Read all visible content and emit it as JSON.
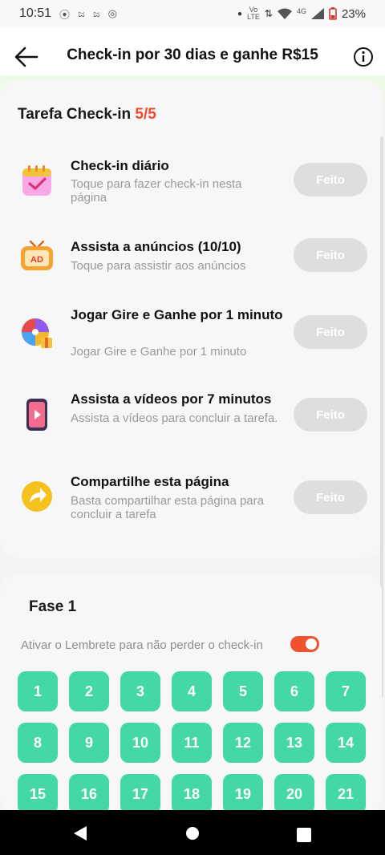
{
  "status_bar": {
    "time": "10:51",
    "net_top": "Vo",
    "net_bottom": "LTE",
    "net_type": "4G",
    "battery": "23%"
  },
  "header": {
    "title": "Check-in por 30 dias e ganhe R$15"
  },
  "tasks_card": {
    "title": "Tarefa Check-in",
    "count": "5/5",
    "tasks": [
      {
        "name": "Check-in diário",
        "desc": "Toque para fazer check-in nesta página",
        "button": "Feito",
        "icon": "calendar-check-icon"
      },
      {
        "name": "Assista a anúncios  (10/10)",
        "desc": "Toque para assistir aos anúncios",
        "button": "Feito",
        "icon": "ad-tv-icon"
      },
      {
        "name": "Jogar Gire e Ganhe por 1 minuto",
        "desc": "Jogar Gire e Ganhe por 1 minuto",
        "button": "Feito",
        "icon": "spin-wheel-icon"
      },
      {
        "name": "Assista a vídeos por 7 minutos",
        "desc": "Assista a vídeos para concluir a tarefa.",
        "button": "Feito",
        "icon": "video-phone-icon"
      },
      {
        "name": "Compartilhe esta página",
        "desc": "Basta compartilhar esta página para concluir a tarefa",
        "button": "Feito",
        "icon": "share-arrow-icon"
      }
    ]
  },
  "phase": {
    "title": "Fase 1",
    "reminder_label": "Ativar o Lembrete para não perder o check-in",
    "reminder_on": true,
    "days": [
      "1",
      "2",
      "3",
      "4",
      "5",
      "6",
      "7",
      "8",
      "9",
      "10",
      "11",
      "12",
      "13",
      "14",
      "15",
      "16",
      "17",
      "18",
      "19",
      "20",
      "21"
    ]
  },
  "colors": {
    "accent_red": "#ef4a2f",
    "day_green": "#43d8a4",
    "done_gray": "#dedede"
  }
}
